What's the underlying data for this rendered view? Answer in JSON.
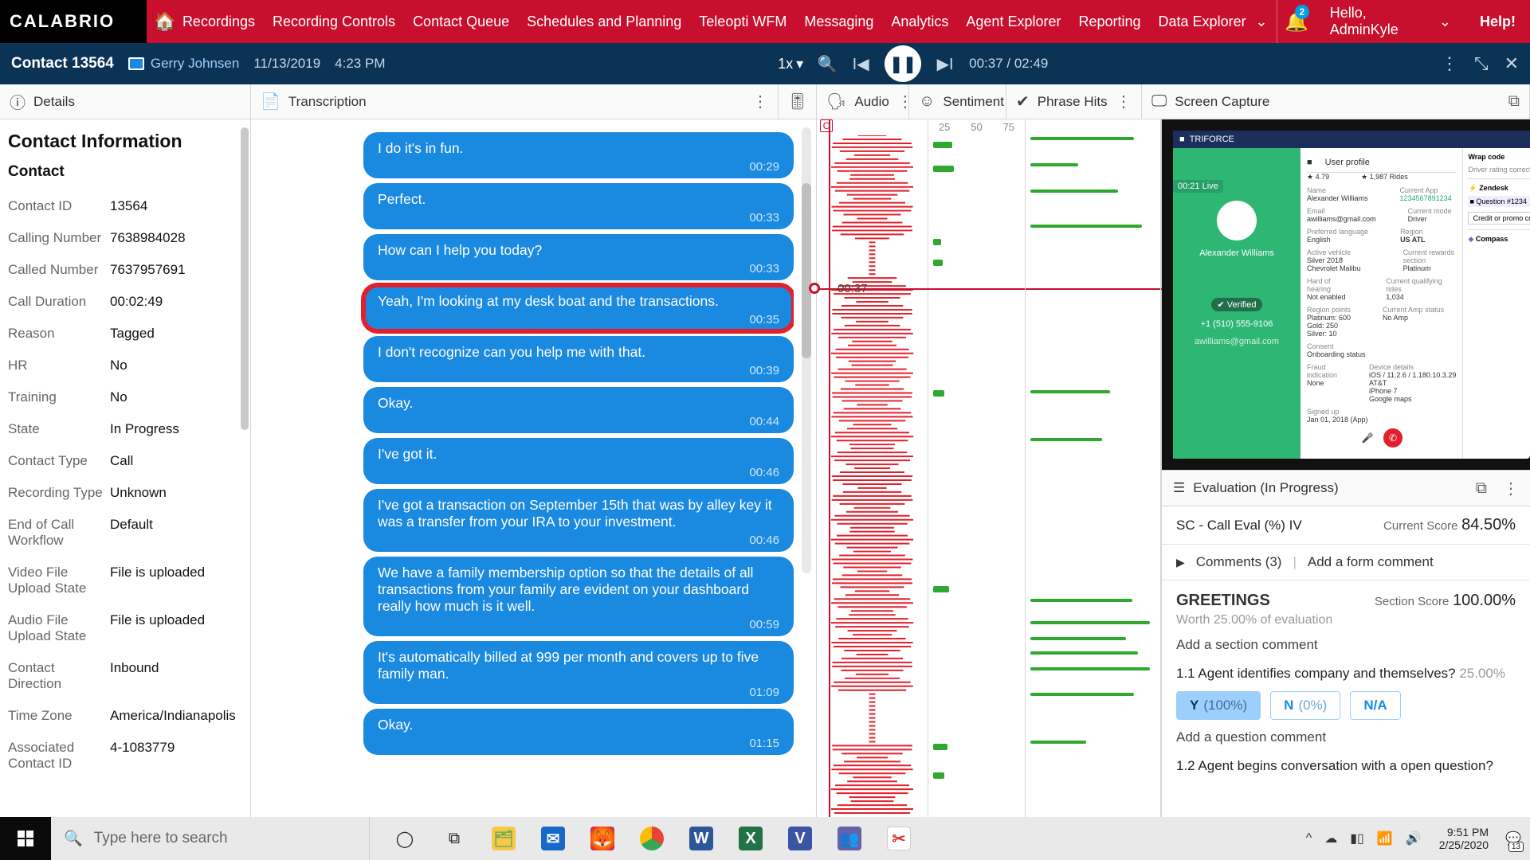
{
  "brand": "CALABRIO",
  "nav": [
    "Recordings",
    "Recording Controls",
    "Contact Queue",
    "Schedules and Planning",
    "Teleopti WFM",
    "Messaging",
    "Analytics",
    "Agent Explorer",
    "Reporting",
    "Data Explorer"
  ],
  "bell_badge": "2",
  "hello": "Hello, AdminKyle",
  "help": "Help!",
  "contact": {
    "title": "Contact 13564",
    "agent": "Gerry Johnsen",
    "date": "11/13/2019",
    "time": "4:23 PM",
    "speed": "1x",
    "pos": "00:37 / 02:49"
  },
  "panes": {
    "details": "Details",
    "transcription": "Transcription",
    "audio": "Audio",
    "sentiment": "Sentiment",
    "phrase": "Phrase Hits",
    "screen": "Screen Capture",
    "evaluation": "Evaluation (In Progress)"
  },
  "details": {
    "heading": "Contact Information",
    "sub": "Contact",
    "rows": [
      {
        "k": "Contact ID",
        "v": "13564"
      },
      {
        "k": "Calling Number",
        "v": "7638984028"
      },
      {
        "k": "Called Number",
        "v": "7637957691"
      },
      {
        "k": "Call Duration",
        "v": "00:02:49"
      },
      {
        "k": "Reason",
        "v": "Tagged"
      },
      {
        "k": "HR",
        "v": "No"
      },
      {
        "k": "Training",
        "v": "No"
      },
      {
        "k": "State",
        "v": "In Progress"
      },
      {
        "k": "Contact Type",
        "v": "Call"
      },
      {
        "k": "Recording Type",
        "v": "Unknown"
      },
      {
        "k": "End of Call Workflow",
        "v": "Default"
      },
      {
        "k": "Video File Upload State",
        "v": "File is uploaded"
      },
      {
        "k": "Audio File Upload State",
        "v": "File is uploaded"
      },
      {
        "k": "Contact Direction",
        "v": "Inbound"
      },
      {
        "k": "Time Zone",
        "v": "America/Indianapolis"
      },
      {
        "k": "Associated Contact ID",
        "v": "4-1083779"
      }
    ]
  },
  "messages": [
    {
      "text": "I do it's in fun.",
      "t": "00:29"
    },
    {
      "text": "Perfect.",
      "t": "00:33"
    },
    {
      "text": "How can I help you today?",
      "t": "00:33"
    },
    {
      "text": "Yeah, I'm looking at my desk boat and the transactions.",
      "t": "00:35",
      "hl": true
    },
    {
      "text": "I don't recognize can you help me with that.",
      "t": "00:39"
    },
    {
      "text": "Okay.",
      "t": "00:44"
    },
    {
      "text": "I've got it.",
      "t": "00:46"
    },
    {
      "text": "I've got a transaction on September 15th that was by alley key it was a transfer from your IRA to your investment.",
      "t": "00:46"
    },
    {
      "text": "We have a family membership option so that the details of all transactions from your family are evident on your dashboard really how much is it well.",
      "t": "00:59"
    },
    {
      "text": "It's automatically billed at 999 per month and covers up to five family man.",
      "t": "01:09"
    },
    {
      "text": "Okay.",
      "t": "01:15"
    }
  ],
  "audio": {
    "letter": "C",
    "scale": [
      "1"
    ],
    "now": "00:37"
  },
  "sentiment": {
    "scale": [
      "25",
      "50",
      "75"
    ]
  },
  "screencap": {
    "appname": "TRIFORCE",
    "status": "00:21 Live",
    "profile": "User profile",
    "name": "Alexander Williams",
    "rating": "★ 4.79",
    "rides": "★ 1,987 Rides",
    "email": "awilliams@gmail.com",
    "lang": "English",
    "vehicle": "Silver 2018 Chevrolet Malibu",
    "hearing": "Not enabled",
    "region": "Platinum: 600\nGold: 250\nSilver: 10",
    "consent": "Onboarding status",
    "phone": "+1 (510) 555-9106",
    "acct": "1234567891234",
    "role": "Driver",
    "city": "US ATL",
    "reward": "Platinum",
    "qrides": "1,034",
    "amp": "No Amp",
    "fraud": "None",
    "signed": "Jan 01, 2018 (App)",
    "device": "iOS / 11.2.6 / 1.180.10.3.29\nAT&T\niPhone 7\nGoogle maps",
    "wrap": "Wrap code",
    "drc": "Driver rating correction",
    "zen": "Zendesk",
    "zq": "Question #1234",
    "comp": "Compass",
    "credit": "Credit or promo code"
  },
  "eval": {
    "form": "SC - Call Eval (%) IV",
    "current_label": "Current Score",
    "current": "84.50%",
    "comments": "Comments (3)",
    "addform": "Add a form comment",
    "section": "GREETINGS",
    "section_score_label": "Section Score",
    "section_score": "100.00%",
    "worth": "Worth 25.00% of evaluation",
    "addsection": "Add a section comment",
    "q1": "1.1 Agent identifies company and themselves?",
    "q1p": "25.00%",
    "opts": [
      {
        "l": "Y",
        "p": "(100%)",
        "sel": true
      },
      {
        "l": "N",
        "p": "(0%)"
      },
      {
        "l": "N/A",
        "p": ""
      }
    ],
    "addq": "Add a question comment",
    "q2": "1.2 Agent begins conversation with a open question?"
  },
  "taskbar": {
    "search_ph": "Type here to search",
    "clock": "9:51 PM",
    "date": "2/25/2020",
    "notif": "13"
  }
}
